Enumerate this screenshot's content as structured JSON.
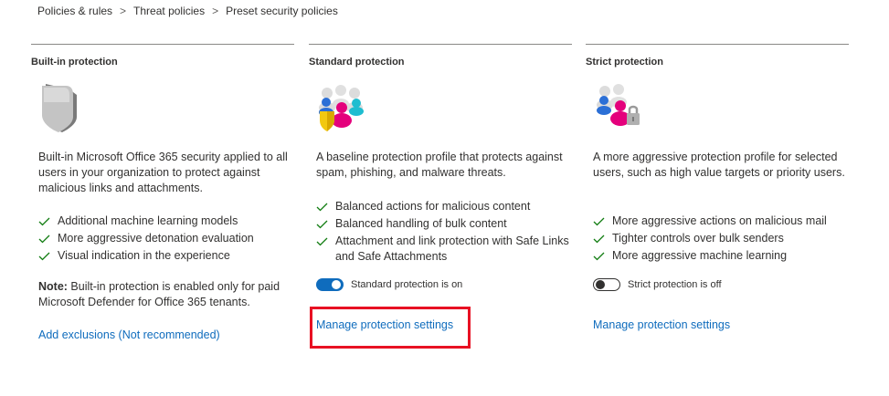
{
  "breadcrumb": {
    "items": [
      "Policies & rules",
      "Threat policies",
      "Preset security policies"
    ],
    "separator": ">"
  },
  "columns": {
    "builtin": {
      "title": "Built-in protection",
      "icon": "grey-shield-illustration",
      "description": "Built-in Microsoft Office 365 security applied to all users in your organization to protect against malicious links and attachments.",
      "checks": [
        "Additional machine learning models",
        "More aggressive detonation evaluation",
        "Visual indication in the experience"
      ],
      "note_label": "Note:",
      "note_text": " Built-in protection is enabled only for paid Microsoft Defender for Office 365 tenants.",
      "link": "Add exclusions (Not recommended)"
    },
    "standard": {
      "title": "Standard protection",
      "icon": "users-with-shield-illustration",
      "description": "A baseline protection profile that protects against spam, phishing, and malware threats.",
      "checks": [
        "Balanced actions for malicious content",
        "Balanced handling of bulk content",
        "Attachment and link protection with Safe Links and Safe Attachments"
      ],
      "toggle_state": "on",
      "toggle_label": "Standard protection is on",
      "link": "Manage protection settings"
    },
    "strict": {
      "title": "Strict protection",
      "icon": "users-with-lock-illustration",
      "description": "A more aggressive protection profile for selected users, such as high value targets or priority users.",
      "checks": [
        "More aggressive actions on malicious mail",
        "Tighter controls over bulk senders",
        "More aggressive machine learning"
      ],
      "toggle_state": "off",
      "toggle_label": "Strict protection is off",
      "link": "Manage protection settings"
    }
  },
  "colors": {
    "accent": "#0f6cbd",
    "check": "#107c10",
    "highlight": "#e81123"
  }
}
